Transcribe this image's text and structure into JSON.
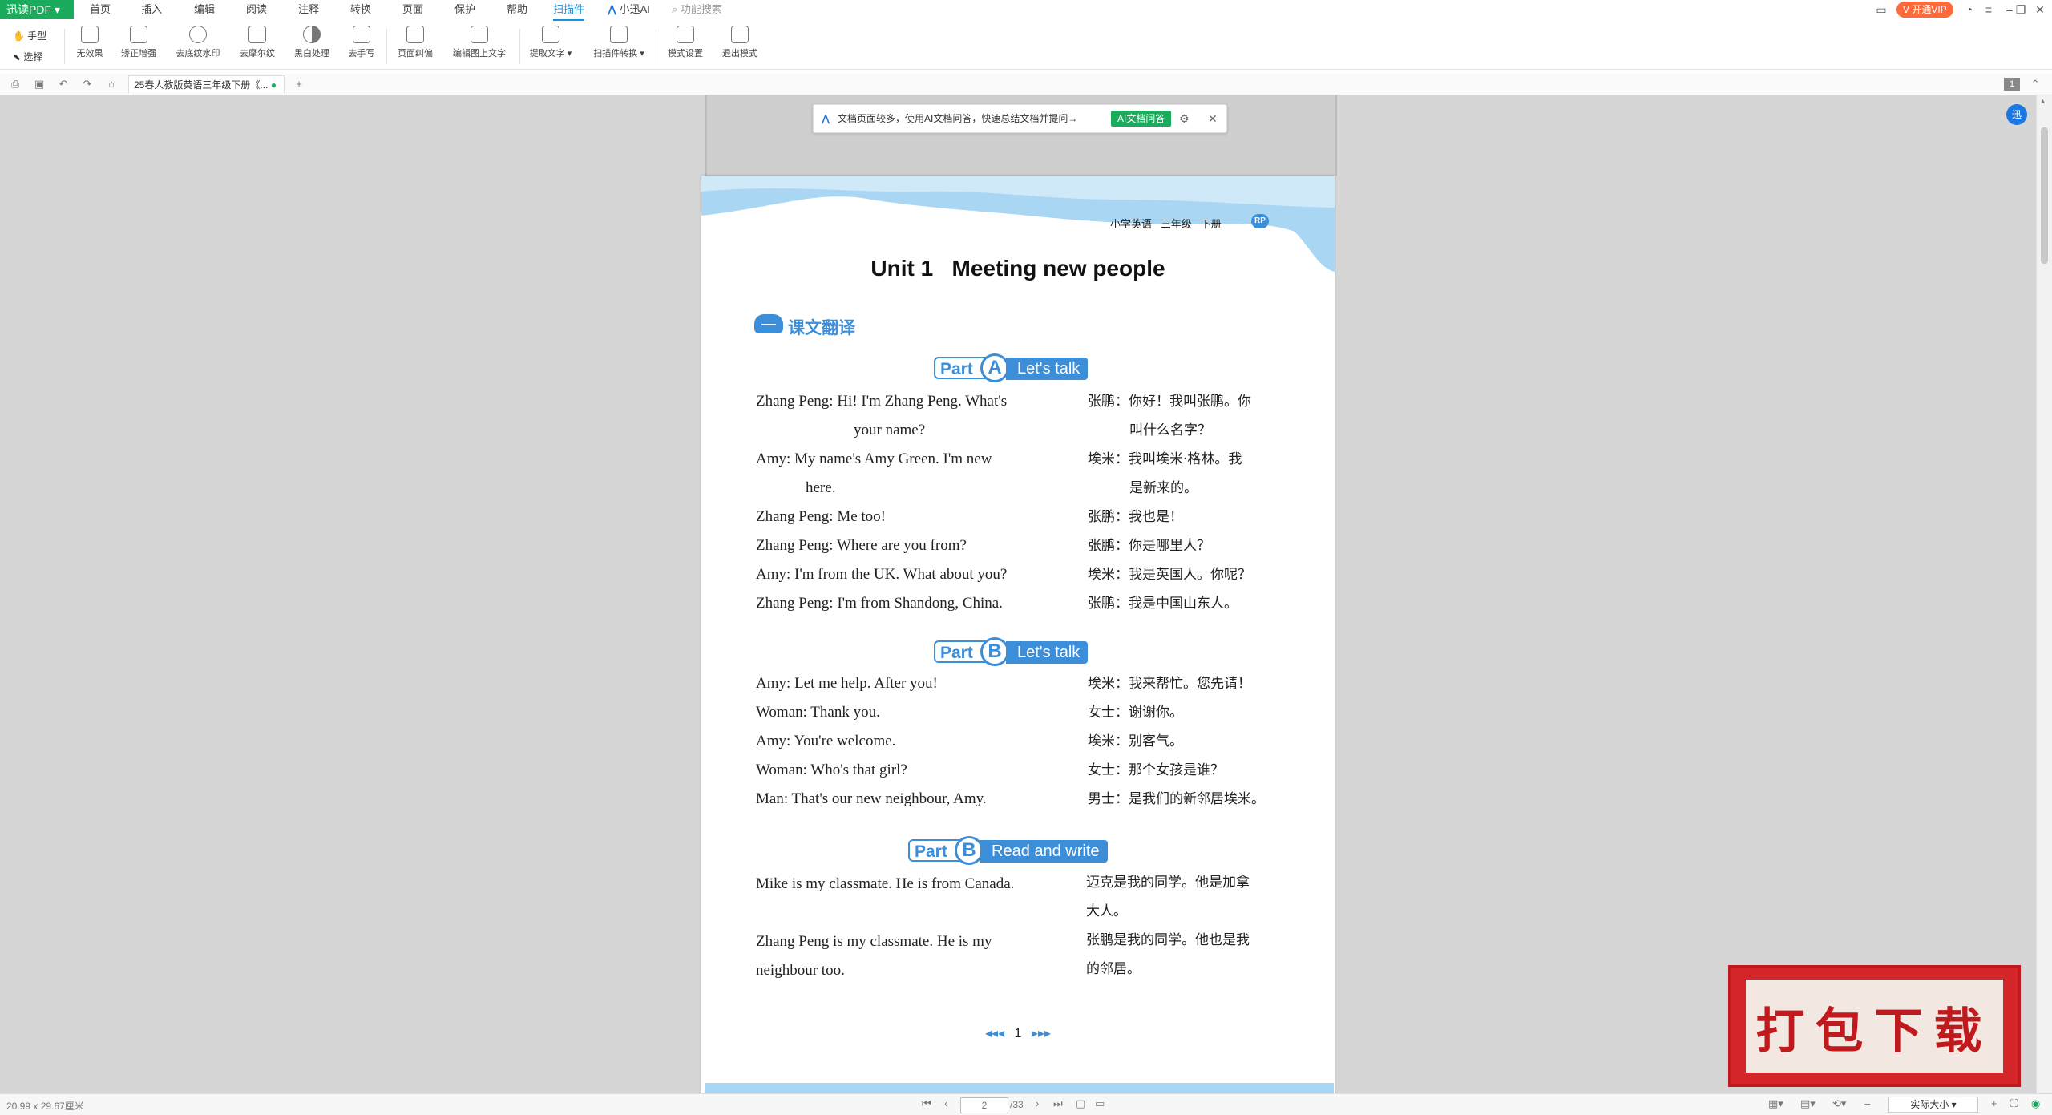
{
  "app": {
    "name": "迅读PDF",
    "menu": [
      "首页",
      "插入",
      "编辑",
      "阅读",
      "注释",
      "转换",
      "页面",
      "保护",
      "帮助",
      "扫描件",
      "小迅AI",
      "功能搜索"
    ],
    "active_menu": "扫描件",
    "vip_label": "开通VIP"
  },
  "ribbon": {
    "hand": "手型",
    "select": "选择",
    "tools": [
      "无效果",
      "矫正增强",
      "去底纹水印",
      "去摩尔纹",
      "黑白处理",
      "去手写",
      "页面纠偏",
      "编辑图上文字",
      "提取文字",
      "扫描件转换",
      "模式设置",
      "退出模式"
    ]
  },
  "tabbar": {
    "doc_tab": "25春人教版英语三年级下册《...",
    "page_count_badge": "1"
  },
  "banner": {
    "text": "文档页面较多，使用AI文档问答，快速总结文档并提问→",
    "button": "AI文档问答"
  },
  "page": {
    "header_tag": "小学英语   三年级   下册",
    "header_badge": "RP",
    "unit_title": "Unit 1   Meeting new people",
    "section_title": "课文翻译",
    "section_a": {
      "part": "Part",
      "letter": "A",
      "title": "Let's talk"
    },
    "dialog_a": [
      {
        "en1": "Zhang Peng: Hi! I'm Zhang Peng. What's",
        "en2": "your name?",
        "zh1": "张鹏：你好！我叫张鹏。你",
        "zh2": "叫什么名字？"
      },
      {
        "en1": "Amy: My name's Amy Green. I'm new",
        "en2": "here.",
        "zh1": "埃米：我叫埃米·格林。我",
        "zh2": "是新来的。"
      },
      {
        "en1": "Zhang Peng: Me too!",
        "zh1": "张鹏：我也是！"
      },
      {
        "en1": "Zhang Peng: Where are you from?",
        "zh1": "张鹏：你是哪里人？"
      },
      {
        "en1": "Amy: I'm from the UK. What about you?",
        "zh1": "埃米：我是英国人。你呢？"
      },
      {
        "en1": "Zhang Peng: I'm from Shandong, China.",
        "zh1": "张鹏：我是中国山东人。"
      }
    ],
    "section_b1": {
      "part": "Part",
      "letter": "B",
      "title": "Let's talk"
    },
    "dialog_b": [
      {
        "en1": "Amy: Let me help. After you!",
        "zh1": "埃米：我来帮忙。您先请！"
      },
      {
        "en1": "Woman: Thank you.",
        "zh1": "女士：谢谢你。"
      },
      {
        "en1": "Amy: You're welcome.",
        "zh1": "埃米：别客气。"
      },
      {
        "en1": "Woman: Who's that girl?",
        "zh1": "女士：那个女孩是谁？"
      },
      {
        "en1": "Man: That's our new neighbour, Amy.",
        "zh1": "男士：是我们的新邻居埃米。"
      }
    ],
    "section_b2": {
      "part": "Part",
      "letter": "B",
      "title": "Read and write"
    },
    "reading": [
      {
        "en1": "Mike is my classmate. He is from Canada.",
        "zh1": "迈克是我的同学。他是加拿",
        "zh2": "大人。"
      },
      {
        "en1": "Zhang Peng is my classmate. He is my",
        "en2": "neighbour too.",
        "zh1": "张鹏是我的同学。他也是我",
        "zh2": "的邻居。"
      }
    ],
    "page_number": "1"
  },
  "status": {
    "page_size": "20.99 x 29.67厘米",
    "current_page": "2",
    "total_pages": "/33",
    "zoom": "实际大小"
  },
  "stamp_text": "打包下载"
}
